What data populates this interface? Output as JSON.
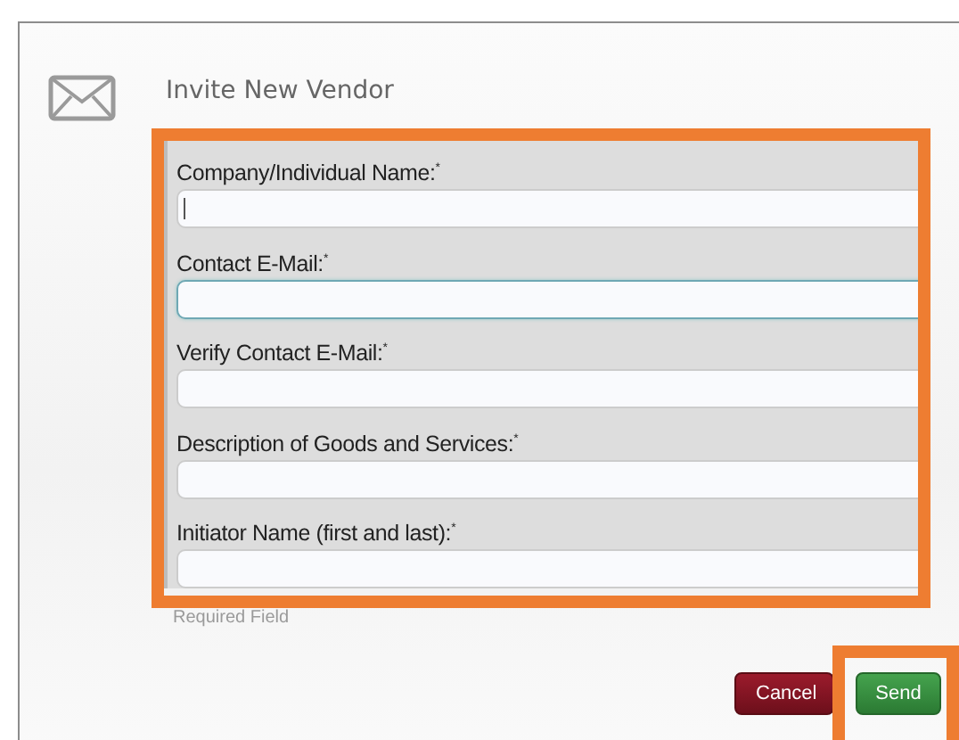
{
  "dialog": {
    "title": "Invite New Vendor",
    "fields": [
      {
        "label": "Company/Individual Name:$^{*}$",
        "focused": false,
        "cursor": true
      },
      {
        "label": "Contact E-Mail:$^{*}$",
        "focused": true,
        "cursor": false
      },
      {
        "label": "Verify Contact E-Mail:$^{*}$",
        "focused": false,
        "cursor": false
      },
      {
        "label": "Description of Goods and Services:$^{*}$",
        "focused": false,
        "cursor": false
      },
      {
        "label": "Initiator Name (first and last):$^{*}$",
        "focused": false,
        "cursor": false
      }
    ],
    "note": "Required Field",
    "buttons": [
      {
        "label": "Cancel",
        "kind": "cancel",
        "highlighted": false
      },
      {
        "label": "Send",
        "kind": "send",
        "highlighted": true
      }
    ]
  }
}
